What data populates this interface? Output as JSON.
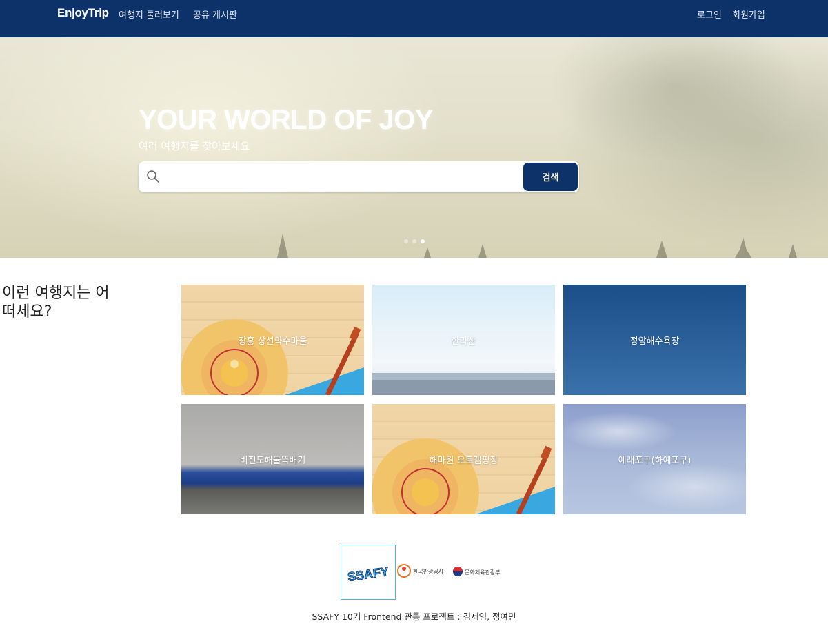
{
  "navbar": {
    "brand": "EnjoyTrip",
    "links": [
      "여행지 둘러보기",
      "공유 게시판"
    ],
    "login": "로그인",
    "signup": "회원가입"
  },
  "hero": {
    "title": "YOUR WORLD OF JOY",
    "subtitle": "여러 여행지를 찾아보세요",
    "search": {
      "placeholder": "",
      "value": "",
      "button": "검색"
    },
    "carousel": {
      "slides": 3,
      "active_index": 2
    }
  },
  "recommend": {
    "title": "이런 여행지는 어떠세요?",
    "cards": [
      {
        "name": "장흥 상선약수마을"
      },
      {
        "name": "한라산"
      },
      {
        "name": "정암해수욕장"
      },
      {
        "name": "비진도해물뚝배기"
      },
      {
        "name": "해마원 오토캠핑장"
      },
      {
        "name": "예래포구(하예포구)"
      }
    ]
  },
  "footer": {
    "logos": [
      "SSAFY",
      "한국관광공사",
      "문화체육관광부"
    ],
    "credit": "SSAFY 10기 Frontend 관통 프로젝트 : 김제영, 정여민"
  },
  "colors": {
    "primary": "#0c3269",
    "logo_border": "#55b8d8"
  }
}
